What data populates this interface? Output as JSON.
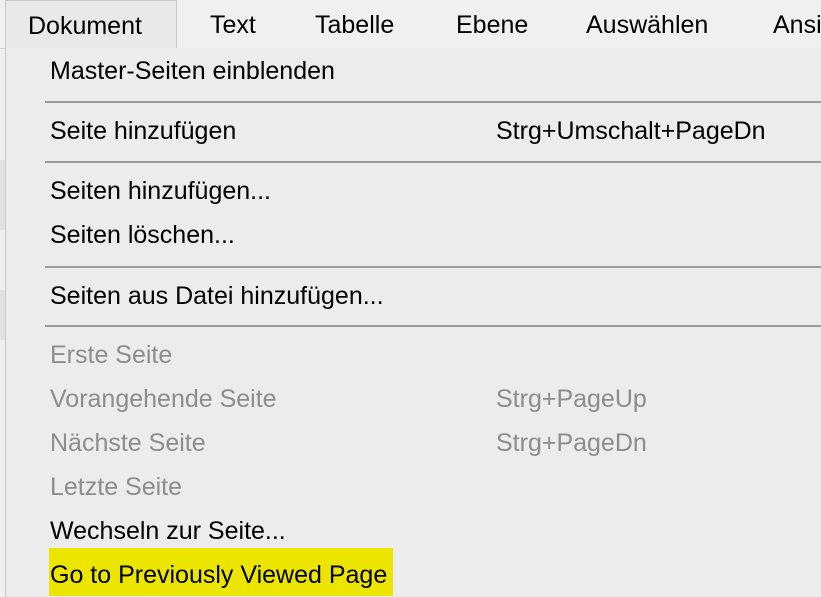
{
  "menubar": {
    "items": [
      {
        "label": "Dokument"
      },
      {
        "label": "Text"
      },
      {
        "label": "Tabelle"
      },
      {
        "label": "Ebene"
      },
      {
        "label": "Auswählen"
      },
      {
        "label": "Ansi"
      }
    ]
  },
  "dropdown": {
    "items": [
      {
        "label": "Master-Seiten einblenden",
        "shortcut": "",
        "enabled": true
      },
      {
        "label": "Seite hinzufügen",
        "shortcut": "Strg+Umschalt+PageDn",
        "enabled": true
      },
      {
        "label": "Seiten hinzufügen...",
        "shortcut": "",
        "enabled": true
      },
      {
        "label": "Seiten löschen...",
        "shortcut": "",
        "enabled": true
      },
      {
        "label": "Seiten aus Datei hinzufügen...",
        "shortcut": "",
        "enabled": true
      },
      {
        "label": "Erste Seite",
        "shortcut": "",
        "enabled": false
      },
      {
        "label": "Vorangehende Seite",
        "shortcut": "Strg+PageUp",
        "enabled": false
      },
      {
        "label": "Nächste Seite",
        "shortcut": "Strg+PageDn",
        "enabled": false
      },
      {
        "label": "Letzte Seite",
        "shortcut": "",
        "enabled": false
      },
      {
        "label": "Wechseln zur Seite...",
        "shortcut": "",
        "enabled": true
      },
      {
        "label": "Go to Previously Viewed Page",
        "shortcut": "",
        "enabled": true,
        "highlighted": true
      }
    ]
  },
  "colors": {
    "highlight": "#ebe500",
    "disabled_text": "#8d8d8d",
    "separator": "#9b9b9b"
  }
}
